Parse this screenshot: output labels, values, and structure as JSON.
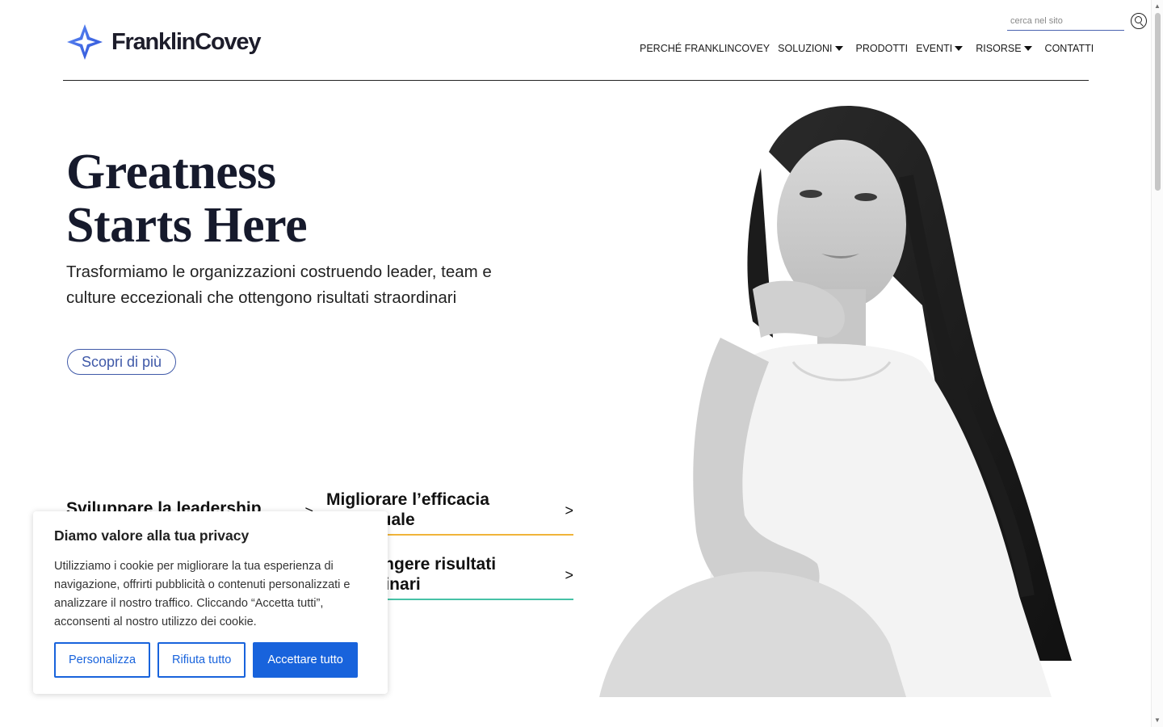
{
  "header": {
    "logo_text": "FranklinCovey",
    "search_placeholder": "cerca nel sito",
    "nav": [
      {
        "label": "PERCHÉ FRANKLINCOVEY",
        "has_dropdown": false
      },
      {
        "label": "SOLUZIONI",
        "has_dropdown": true
      },
      {
        "label": "PRODOTTI",
        "has_dropdown": false
      },
      {
        "label": "EVENTI",
        "has_dropdown": true
      },
      {
        "label": "RISORSE",
        "has_dropdown": true
      },
      {
        "label": "CONTATTI",
        "has_dropdown": false
      }
    ]
  },
  "hero": {
    "title_line1": "Greatness",
    "title_line2": "Starts Here",
    "subtitle": "Trasformiamo le organizzazioni costruendo leader, team e culture eccezionali che ottengono risultati straordinari",
    "cta_label": "Scopri di più"
  },
  "links": [
    {
      "label": "Sviluppare la leadership",
      "chevron": ">"
    },
    {
      "label": "Migliorare l’efficacia individuale",
      "chevron": ">"
    },
    {
      "label": "Raggiungere risultati straordinari",
      "chevron": ">"
    }
  ],
  "cookie": {
    "title": "Diamo valore alla tua privacy",
    "body": "Utilizziamo i cookie per migliorare la tua esperienza di navigazione, offrirti pubblicità o contenuti personalizzati e analizzare il nostro traffico. Cliccando “Accetta tutti”, acconsenti al nostro utilizzo dei cookie.",
    "btn_customize": "Personalizza",
    "btn_reject": "Rifiuta tutto",
    "btn_accept": "Accettare tutto"
  },
  "colors": {
    "brand_blue": "#3f59a8",
    "cookie_blue": "#1863dc",
    "accent_yellow": "#f0b43a",
    "accent_teal": "#46c2a6"
  }
}
